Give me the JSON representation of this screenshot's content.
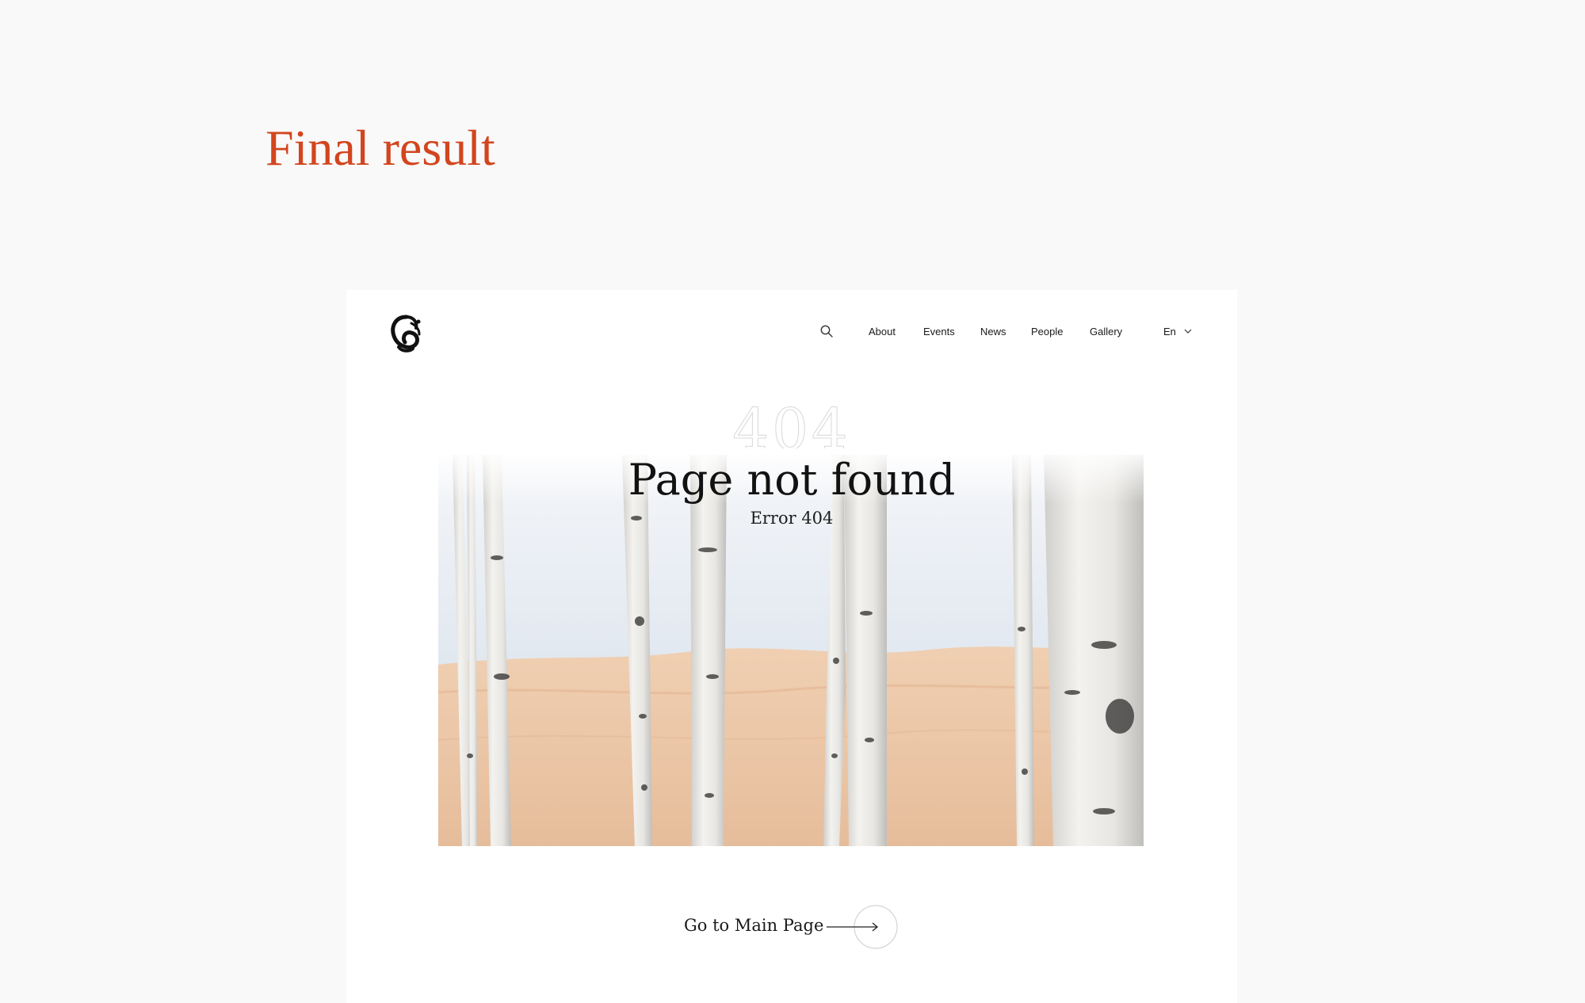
{
  "heading": "Final result",
  "nav": {
    "items": [
      {
        "label": "About"
      },
      {
        "label": "Events"
      },
      {
        "label": "News"
      },
      {
        "label": "People"
      },
      {
        "label": "Gallery"
      }
    ],
    "language": "En",
    "search_icon": "search-icon"
  },
  "hero": {
    "background_code": "404",
    "title": "Page not found",
    "subtitle": "Error 404"
  },
  "cta": {
    "label": "Go to Main Page",
    "icon": "arrow-right-icon"
  },
  "colors": {
    "accent": "#d2451e",
    "page_background": "#f9f9f9",
    "card_background": "#ffffff",
    "sand": "#eac5a5",
    "sky": "#dde6f0",
    "bark": "#ecebe8"
  }
}
